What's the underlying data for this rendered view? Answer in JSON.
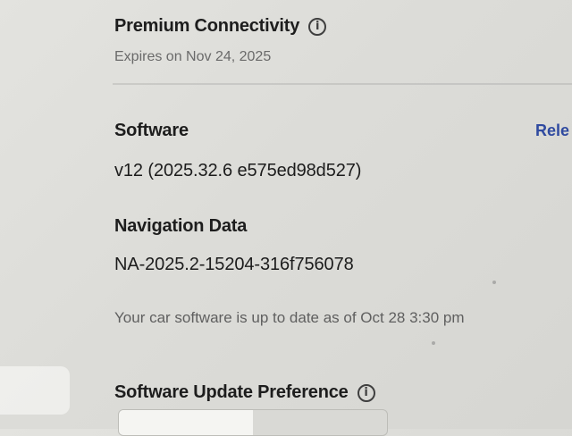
{
  "premium": {
    "title": "Premium Connectivity",
    "subtitle": "Expires on Nov 24, 2025",
    "icon": "info-icon"
  },
  "software": {
    "title": "Software",
    "version": "v12 (2025.32.6 e575ed98d527)",
    "release_link": "Rele"
  },
  "navigation_data": {
    "title": "Navigation Data",
    "value": "NA-2025.2-15204-316f756078"
  },
  "status": {
    "message": "Your car software is up to date as of Oct 28 3:30 pm"
  },
  "software_update_preference": {
    "title": "Software Update Preference",
    "icon": "info-icon"
  }
}
